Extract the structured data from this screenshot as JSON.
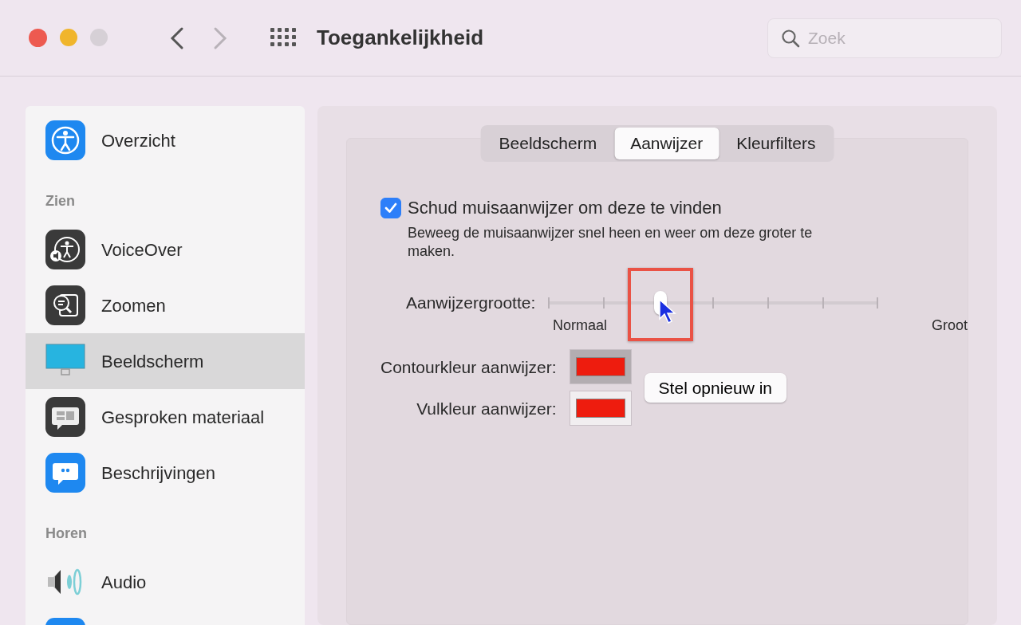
{
  "window": {
    "title": "Toegankelijkheid",
    "back_enabled": true,
    "forward_enabled": false
  },
  "search": {
    "placeholder": "Zoek"
  },
  "sidebar": {
    "items": [
      {
        "kind": "overview",
        "label": "Overzicht",
        "selected": false
      },
      {
        "kind": "heading",
        "label": "Zien"
      },
      {
        "kind": "voiceover",
        "label": "VoiceOver",
        "selected": false
      },
      {
        "kind": "zoom",
        "label": "Zoomen",
        "selected": false
      },
      {
        "kind": "display",
        "label": "Beeldscherm",
        "selected": true
      },
      {
        "kind": "spoken",
        "label": "Gesproken materiaal",
        "selected": false
      },
      {
        "kind": "descriptions",
        "label": "Beschrijvingen",
        "selected": false
      },
      {
        "kind": "heading",
        "label": "Horen"
      },
      {
        "kind": "audio",
        "label": "Audio",
        "selected": false
      },
      {
        "kind": "partial",
        "selected": false
      }
    ]
  },
  "tabs": [
    {
      "label": "Beeldscherm",
      "selected": false
    },
    {
      "label": "Aanwijzer",
      "selected": true
    },
    {
      "label": "Kleurfilters",
      "selected": false
    }
  ],
  "shake": {
    "label": "Schud muisaanwijzer om deze te vinden",
    "checked": true,
    "description": "Beweeg de muisaanwijzer snel heen en weer om deze groter te maken."
  },
  "size_slider": {
    "label": "Aanwijzergrootte:",
    "level": 0.34,
    "min_label": "Normaal",
    "max_label": "Groot",
    "highlighted": true
  },
  "color_wells": [
    {
      "label": "Contourkleur aanwijzer:",
      "color": "#ee1c0e",
      "pressed": true
    },
    {
      "label": "Vulkleur aanwijzer:",
      "color": "#ee1c0e",
      "pressed": false
    }
  ],
  "reset_button": {
    "label": "Stel opnieuw in"
  }
}
